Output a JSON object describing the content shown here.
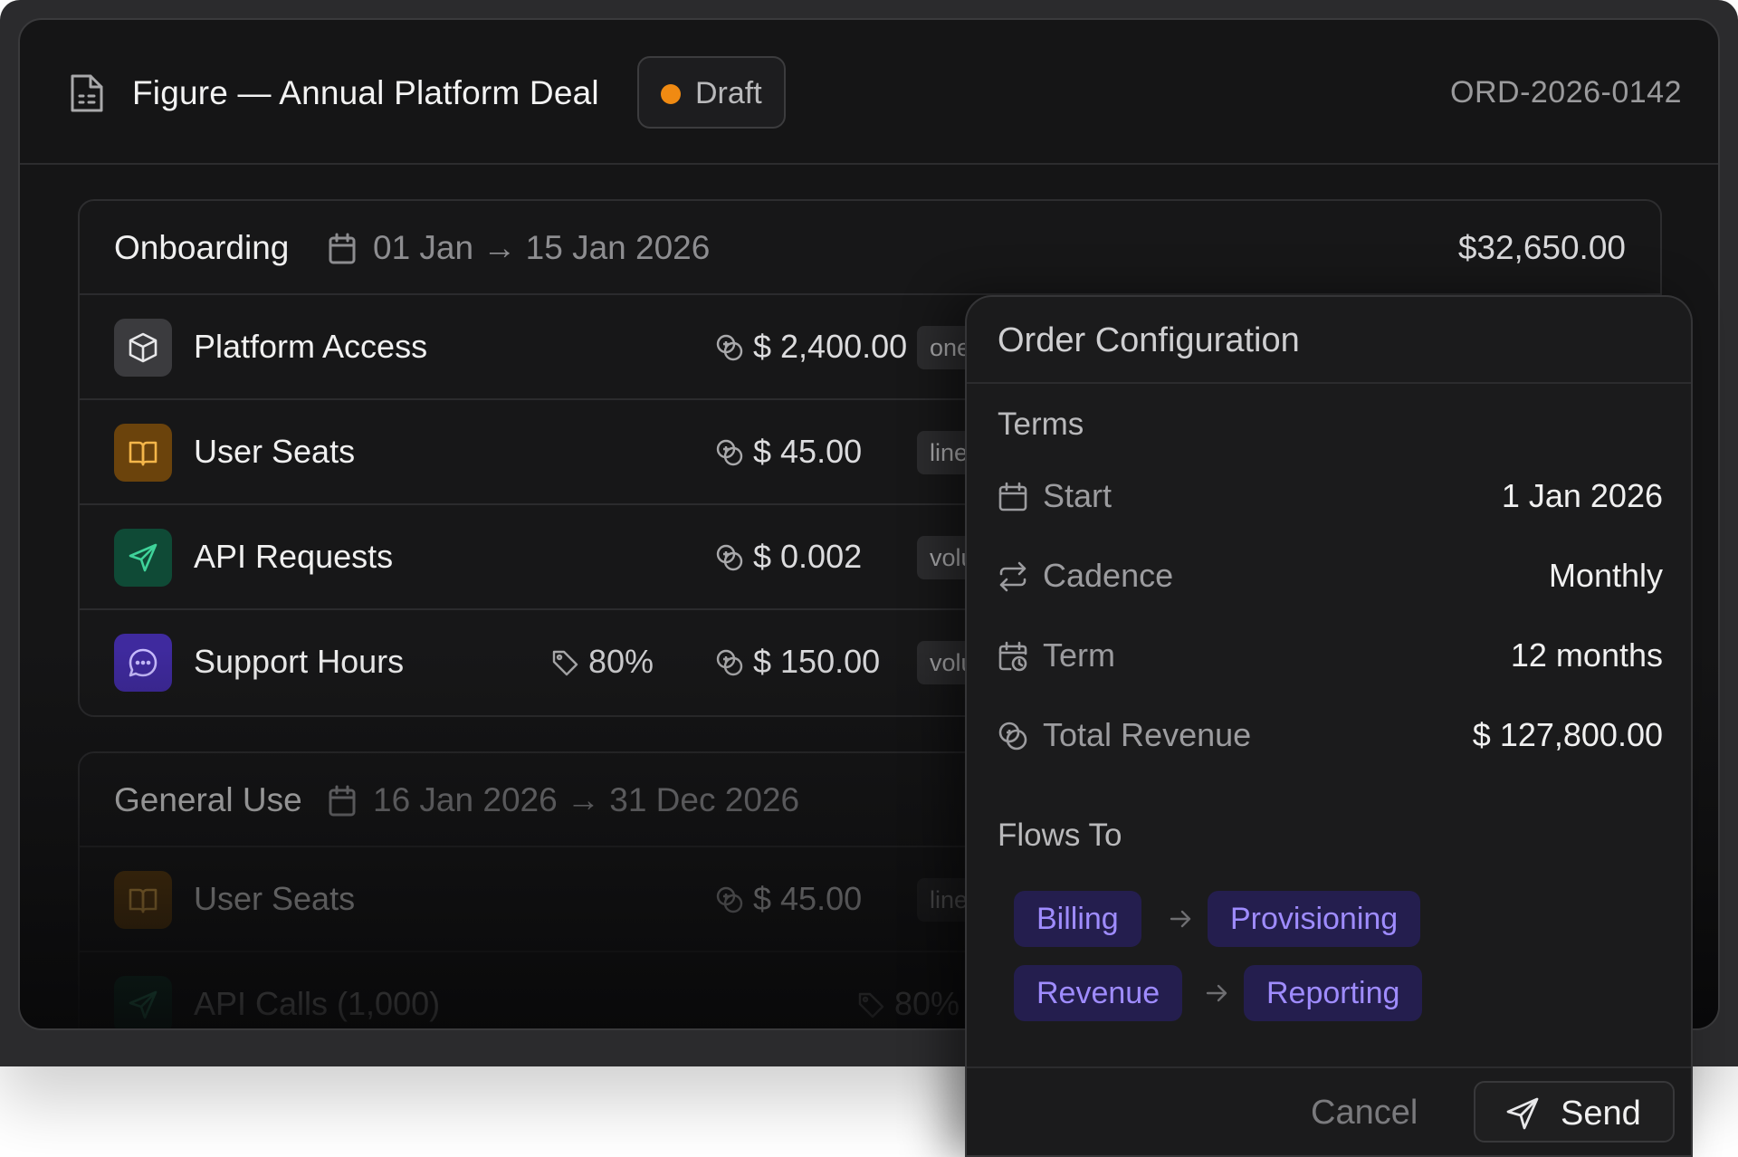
{
  "header": {
    "title": "Figure — Annual Platform Deal",
    "status": "Draft",
    "status_color": "#f08a12",
    "order_id": "ORD-2026-0142"
  },
  "phases": [
    {
      "name": "Onboarding",
      "dates": "01 Jan → 15 Jan 2026",
      "total": "$32,650.00",
      "items": [
        {
          "name": "Platform Access",
          "icon": "box-icon",
          "price": "$ 2,400.00",
          "pricing_model": "one",
          "discount": ""
        },
        {
          "name": "User Seats",
          "icon": "book-icon",
          "price": "$ 45.00",
          "pricing_model": "line",
          "discount": ""
        },
        {
          "name": "API Requests",
          "icon": "send-icon",
          "price": "$ 0.002",
          "pricing_model": "volu",
          "discount": ""
        },
        {
          "name": "Support Hours",
          "icon": "chat-icon",
          "price": "$ 150.00",
          "pricing_model": "volu",
          "discount": "80%"
        }
      ]
    },
    {
      "name": "General Use",
      "dates": "16 Jan 2026 → 31 Dec 2026",
      "total": "",
      "items": [
        {
          "name": "User Seats",
          "icon": "book-icon",
          "price": "$ 45.00",
          "pricing_model": "line",
          "discount": ""
        },
        {
          "name": "API Calls (1,000)",
          "icon": "send-icon",
          "price": "",
          "pricing_model": "",
          "discount": "80%"
        }
      ]
    }
  ],
  "order_configuration": {
    "title": "Order Configuration",
    "terms_heading": "Terms",
    "terms": [
      {
        "label": "Start",
        "value": "1 Jan 2026",
        "icon": "calendar-icon"
      },
      {
        "label": "Cadence",
        "value": "Monthly",
        "icon": "repeat-icon"
      },
      {
        "label": "Term",
        "value": "12 months",
        "icon": "calendar-clock-icon"
      },
      {
        "label": "Total Revenue",
        "value": "$ 127,800.00",
        "icon": "coins-icon"
      }
    ],
    "flows_heading": "Flows To",
    "flows": [
      [
        "Billing",
        "Provisioning"
      ],
      [
        "Revenue",
        "Reporting"
      ]
    ],
    "cancel_label": "Cancel",
    "send_label": "Send"
  },
  "colors": {
    "accent_purple": "#9f8cff",
    "platform_icon_bg": "#3b3b3e",
    "seats_icon_bg": "#6b430c",
    "api_icon_bg": "#0f4a36",
    "support_icon_bg": "#3f2a9e"
  }
}
